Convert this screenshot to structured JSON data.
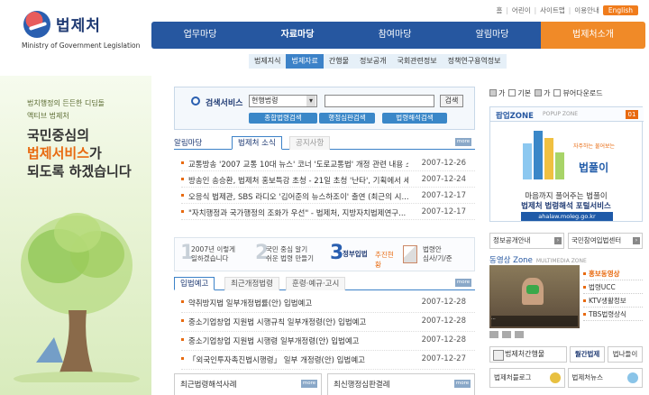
{
  "site": {
    "logo_name": "법제처",
    "logo_sub": "Ministry of Government Legislation"
  },
  "util_links": [
    "홈",
    "어린이",
    "사이트맵",
    "이용안내"
  ],
  "english_button": "English",
  "gnb": {
    "items": [
      "업무마당",
      "자료마당",
      "참여마당",
      "알림마당"
    ],
    "intro": "법제처소개"
  },
  "subnav": [
    "법제지식",
    "법제자료",
    "간행물",
    "정보공개",
    "국회관련정보",
    "정책연구용역정보"
  ],
  "visual": {
    "slogan_small_1": "법치행정의 든든한 디딤돌",
    "slogan_small_2": "액티브 법제처",
    "slogan_big_1": "국민중심의",
    "slogan_big_2a": "법제서비스",
    "slogan_big_2b": "가",
    "slogan_big_3": "되도록 하겠습니다"
  },
  "search": {
    "label": "검색서비스",
    "select_value": "현행법령",
    "button": "검색",
    "quick_buttons": [
      "종합법령검색",
      "행정심판검색",
      "법령해석검색"
    ]
  },
  "notice": {
    "section_label": "알림마당",
    "tab_active": "법제처 소식",
    "tab_inactive": "공지사항",
    "more": "more",
    "items": [
      {
        "title": "교통방송 '2007 교통 10대 뉴스' 코너 '도로교통법' 개정 관련 내용 소개",
        "date": "2007-12-26"
      },
      {
        "title": "방송인 송승환, 법제처 홍보특강 초청 - 21일 초청 '난타', 기획에서 세계...",
        "date": "2007-12-24"
      },
      {
        "title": "오응식 법제관, SBS 라디오 '김어준의 뉴스하조이' 출연 (최근의 시...",
        "date": "2007-12-17"
      },
      {
        "title": "\"자치행정과 국가행정의 조화가 우선\" - 법제처, 지방자치법제연구...",
        "date": "2007-12-17"
      }
    ]
  },
  "steps": [
    {
      "num": "1",
      "text_1": "2007년 이렇게",
      "text_2": "일하겠습니다"
    },
    {
      "num": "2",
      "text_1": "국민 중심 알기",
      "text_2": "쉬운 법령 만들기"
    },
    {
      "num": "3",
      "text_1": "정부입법",
      "text_2": "추진현황"
    },
    {
      "num": "4",
      "text_1": "법령안",
      "text_2": "심사/기/준"
    }
  ],
  "legis": {
    "tab_active": "입법예고",
    "tab_2": "최근개정법령",
    "tab_3": "훈령·예규·고시",
    "more": "more",
    "items": [
      {
        "title": "약취방지법 일부개정법률(안) 입법예고",
        "date": "2007-12-28"
      },
      {
        "title": "중소기업창업 지원법 시행규칙 일부개정령(안) 입법예고",
        "date": "2007-12-28"
      },
      {
        "title": "중소기업창업 지원법 시행령 일부개정령(안) 입법예고",
        "date": "2007-12-28"
      },
      {
        "title": "「외국인투자촉진법시행령」 일부 개정령(안) 입법예고",
        "date": "2007-12-27"
      }
    ]
  },
  "bottom_boxes": [
    "최근법령해석사례",
    "최신행정심판결례"
  ],
  "right_tabs": [
    "가",
    "기본",
    "가",
    "뷰어다운로드"
  ],
  "popup_zone": {
    "title": "팝업ZONE",
    "sub": "POPUP ZONE",
    "page": "01",
    "slogan": "자주하는 물어보는",
    "brand": "법풀이",
    "banner_line_1": "마음까지 풀어주는 법풀이",
    "banner_line_2": "법제처 법령해석 포털서비스",
    "url": "ahalaw.moleg.go.kr"
  },
  "right_links": [
    "정보공개안내",
    "국민참여입법센터"
  ],
  "media_zone": {
    "title": "동영상 Zone",
    "sub": "MULTIMEDIA ZONE",
    "items": [
      "홍보동영상",
      "법령UCC",
      "KTV생활정보",
      "TBS법령상식"
    ],
    "caption": "..."
  },
  "pubs": {
    "title": "법제처간행물",
    "tab_1": "월간법제",
    "tab_2": "법나들이"
  },
  "blogs": [
    "법제처블로그",
    "법제처뉴스"
  ],
  "colors": {
    "gnb_blue": "#2657a0",
    "gnb_orange": "#f08a28",
    "accent": "#e86a10"
  }
}
